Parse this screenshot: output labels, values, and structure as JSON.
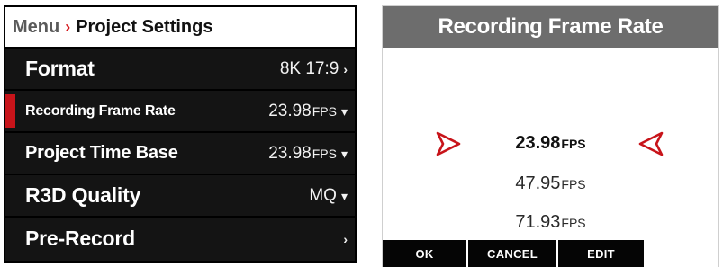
{
  "menu": {
    "breadcrumb": {
      "root": "Menu",
      "separator": "›",
      "current": "Project Settings"
    },
    "rows": [
      {
        "label": "Format",
        "value": "8K 17:9",
        "unit": "",
        "indicator": "›"
      },
      {
        "label": "Recording Frame Rate",
        "value": "23.98",
        "unit": "FPS",
        "indicator": "▾",
        "selected": true
      },
      {
        "label": "Project Time Base",
        "value": "23.98",
        "unit": "FPS",
        "indicator": "▾"
      },
      {
        "label": "R3D Quality",
        "value": "MQ",
        "unit": "",
        "indicator": "▾"
      },
      {
        "label": "Pre-Record",
        "value": "",
        "unit": "",
        "indicator": "›"
      }
    ]
  },
  "picker": {
    "title": "Recording Frame Rate",
    "options": [
      {
        "value": "23.98",
        "unit": "FPS",
        "selected": true
      },
      {
        "value": "47.95",
        "unit": "FPS"
      },
      {
        "value": "71.93",
        "unit": "FPS"
      }
    ],
    "softkeys": [
      "OK",
      "CANCEL",
      "EDIT"
    ]
  },
  "colors": {
    "accent_red": "#c8141a",
    "menu_bg": "#141414",
    "title_bar": "#6d6d6d"
  },
  "icons": {
    "left_selector": "triangle-right-icon",
    "right_selector": "triangle-left-icon"
  }
}
